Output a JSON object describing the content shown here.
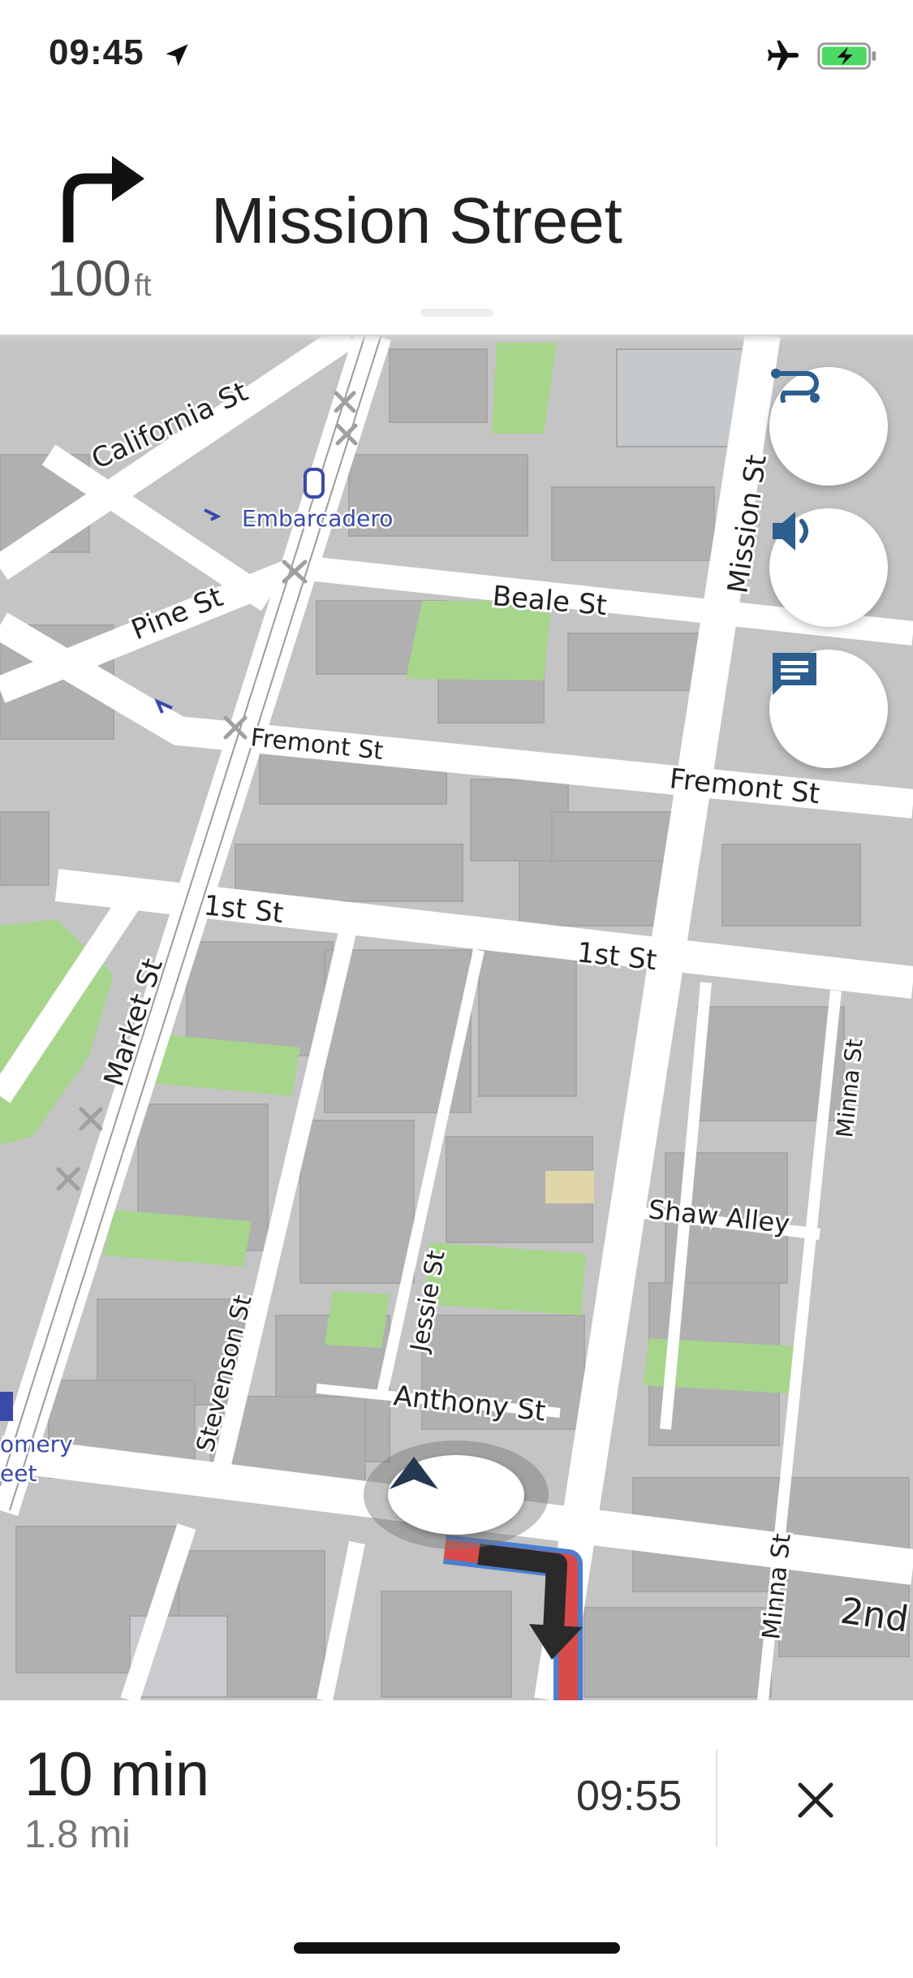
{
  "status_bar": {
    "time": "09:45",
    "icons": [
      "location-arrow-icon",
      "airplane-icon",
      "battery-charging-icon"
    ]
  },
  "instruction": {
    "maneuver_icon": "turn-right-icon",
    "distance_value": "100",
    "distance_unit": "ft",
    "street": "Mission Street"
  },
  "map": {
    "labels": {
      "california": "California St",
      "embarcadero": "Embarcadero",
      "pine": "Pine St",
      "beale": "Beale St",
      "mission": "Mission St",
      "fremont_left": "Fremont St",
      "fremont_right": "Fremont St",
      "first_left": "1st St",
      "first_right": "1st St",
      "market": "Market St",
      "minna_top": "Minna St",
      "shaw": "Shaw Alley",
      "jessie": "Jessie St",
      "stevenson": "Stevenson St",
      "anthony": "Anthony St",
      "montgomery_1": "omery",
      "montgomery_2": "eet",
      "minna_bottom": "Minna St",
      "second": "2nd"
    },
    "buttons": [
      "route-overview-icon",
      "speaker-icon",
      "report-message-icon",
      "recenter-arrow-icon"
    ],
    "colors": {
      "route_blue": "#4a7fd0",
      "route_red": "#d94a4a",
      "accent": "#2d5f8e"
    }
  },
  "trip": {
    "duration": "10 min",
    "distance": "1.8 mi",
    "eta": "09:55",
    "close_icon": "close-icon"
  }
}
